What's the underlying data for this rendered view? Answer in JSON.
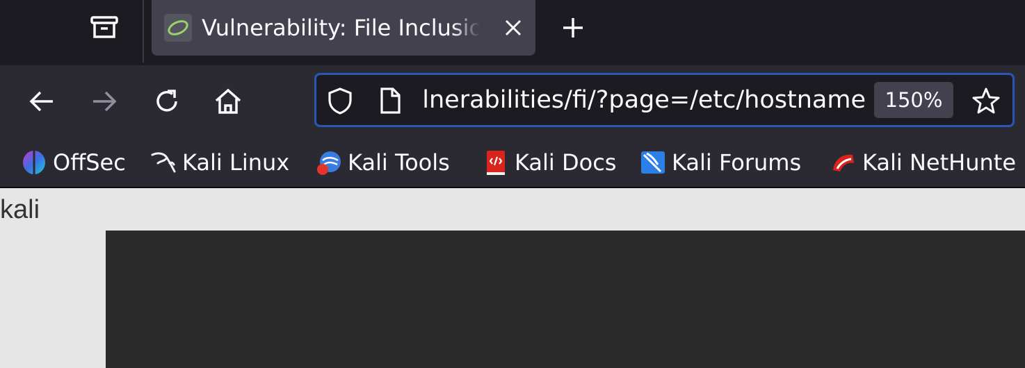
{
  "tab_strip": {
    "active_tab": {
      "title": "Vulnerability: File Inclusion",
      "favicon": "dvwa-swirl-icon"
    },
    "new_tab_label": "+"
  },
  "navbar": {
    "url": "http://localhost/DVWA/vulnerabilities/fi/?page=/etc/hostname",
    "url_visible": "ılnerabilities/fi/?page=/etc/hostname",
    "zoom": "150%"
  },
  "bookmarks": [
    {
      "label": "OffSec",
      "icon": "offsec-icon"
    },
    {
      "label": "Kali Linux",
      "icon": "kali-dragon-icon"
    },
    {
      "label": "Kali Tools",
      "icon": "kali-tools-icon"
    },
    {
      "label": "Kali Docs",
      "icon": "kali-docs-icon"
    },
    {
      "label": "Kali Forums",
      "icon": "kali-forums-icon"
    },
    {
      "label": "Kali NetHunte",
      "icon": "kali-nethunter-icon"
    }
  ],
  "page": {
    "output_text": "kali"
  },
  "colors": {
    "tabstrip_bg": "#1c1b22",
    "toolbar_bg": "#2b2a33",
    "active_tab_bg": "#42414d",
    "urlbar_focus_border": "#2a56b8",
    "page_bg": "#e6e6e6",
    "panel_bg": "#2b2b2b"
  }
}
